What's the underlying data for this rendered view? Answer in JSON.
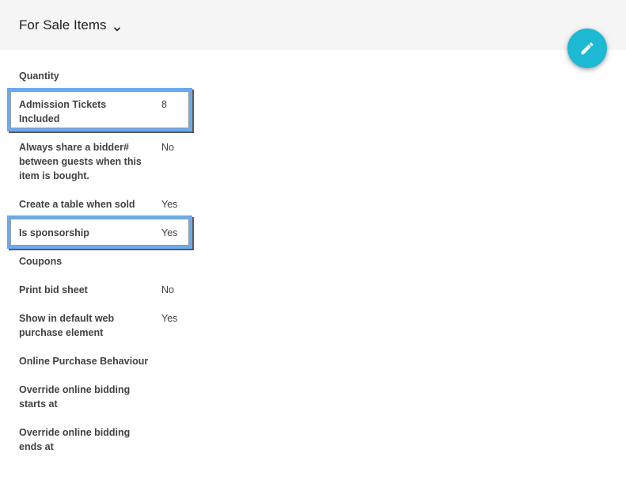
{
  "header": {
    "title": "For Sale Items",
    "dropdown_icon": "chevron-down-icon"
  },
  "fab": {
    "icon": "pencil-icon",
    "color": "#1cb8d4"
  },
  "highlight_color": "#6aaaf0",
  "properties": [
    {
      "label": "Quantity",
      "value": ""
    },
    {
      "label": "Admission Tickets Included",
      "value": "8",
      "highlighted": true
    },
    {
      "label": "Always share a bidder# between guests when this item is bought.",
      "value": "No"
    },
    {
      "label": "Create a table when sold",
      "value": "Yes"
    },
    {
      "label": "Is sponsorship",
      "value": "Yes",
      "highlighted": true
    },
    {
      "label": "Coupons",
      "value": ""
    },
    {
      "label": "Print bid sheet",
      "value": "No"
    },
    {
      "label": "Show in default web purchase element",
      "value": "Yes"
    },
    {
      "label": "Online Purchase Behaviour",
      "value": ""
    },
    {
      "label": "Override online bidding starts at",
      "value": ""
    },
    {
      "label": "Override online bidding ends at",
      "value": ""
    }
  ]
}
